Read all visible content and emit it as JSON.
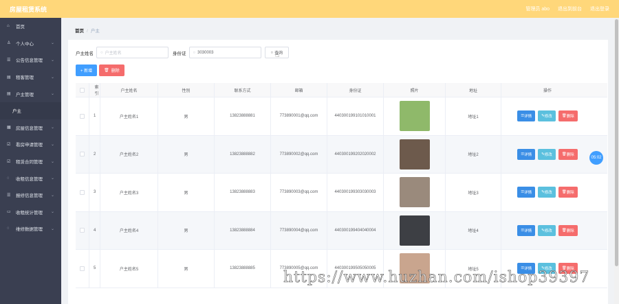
{
  "app": {
    "title": "房屋租赁系统"
  },
  "topbar": {
    "admin_text": "管理员 abo",
    "logout_system": "退出到前台",
    "logout": "退出登录"
  },
  "sidebar": {
    "items": [
      {
        "icon": "home-icon",
        "label": "首页",
        "glyph": "⌂"
      },
      {
        "icon": "user-icon",
        "label": "个人中心",
        "glyph": "♙"
      },
      {
        "icon": "list-icon",
        "label": "公告信息管理",
        "glyph": "☰"
      },
      {
        "icon": "doc-icon",
        "label": "租客管理",
        "glyph": "▤"
      },
      {
        "icon": "doc-icon",
        "label": "户主管理",
        "glyph": "▤"
      },
      {
        "icon": "",
        "label": "户主",
        "glyph": ""
      },
      {
        "icon": "house-icon",
        "label": "房屋信息管理",
        "glyph": "▦"
      },
      {
        "icon": "check-icon",
        "label": "看房申请管理",
        "glyph": "☑"
      },
      {
        "icon": "check-icon",
        "label": "租赁合同管理",
        "glyph": "☑"
      },
      {
        "icon": "chat-icon",
        "label": "收租信息管理",
        "glyph": "◌"
      },
      {
        "icon": "list-icon",
        "label": "报修信息管理",
        "glyph": "☰"
      },
      {
        "icon": "monitor-icon",
        "label": "收租统计管理",
        "glyph": "▭"
      },
      {
        "icon": "chat-icon",
        "label": "维修数据管理",
        "glyph": "◌"
      }
    ]
  },
  "breadcrumb": {
    "home": "首页",
    "sep": "/",
    "current": "户主"
  },
  "search": {
    "name_label": "户主姓名",
    "name_placeholder": "户主姓名",
    "id_label": "身份证",
    "id_value": "3030003",
    "query_btn": "查询",
    "search_glyph": "○"
  },
  "actions": {
    "add": "+ 新增",
    "delete": "删除"
  },
  "table": {
    "headers": [
      "索引",
      "户主姓名",
      "性别",
      "联系方式",
      "邮箱",
      "身份证",
      "照片",
      "地址",
      "操作"
    ],
    "ops": {
      "detail": "详情",
      "edit": "修改",
      "delete": "删除"
    },
    "rows": [
      {
        "idx": "1",
        "name": "户主姓名1",
        "sex": "男",
        "phone": "13823888881",
        "email": "773890001@qq.com",
        "idcard": "440300199101010001",
        "addr": "地址1",
        "photo_bg": "#8fb96a"
      },
      {
        "idx": "2",
        "name": "户主姓名2",
        "sex": "男",
        "phone": "13823888882",
        "email": "773890002@qq.com",
        "idcard": "440300199202020002",
        "addr": "地址2",
        "photo_bg": "#6d5a4c"
      },
      {
        "idx": "3",
        "name": "户主姓名3",
        "sex": "男",
        "phone": "13823888883",
        "email": "773890003@qq.com",
        "idcard": "440300199303030003",
        "addr": "地址3",
        "photo_bg": "#9a8a7c"
      },
      {
        "idx": "4",
        "name": "户主姓名4",
        "sex": "男",
        "phone": "13823888884",
        "email": "773890004@qq.com",
        "idcard": "440300199404040004",
        "addr": "地址4",
        "photo_bg": "#3d3f44"
      },
      {
        "idx": "5",
        "name": "户主姓名5",
        "sex": "男",
        "phone": "13823888885",
        "email": "773890005@qq.com",
        "idcard": "440300199505050005",
        "addr": "地址5",
        "photo_bg": "#c9a58e"
      }
    ]
  },
  "badge": "05:02",
  "watermark": "https://www.huzhan.com/ishop39397"
}
